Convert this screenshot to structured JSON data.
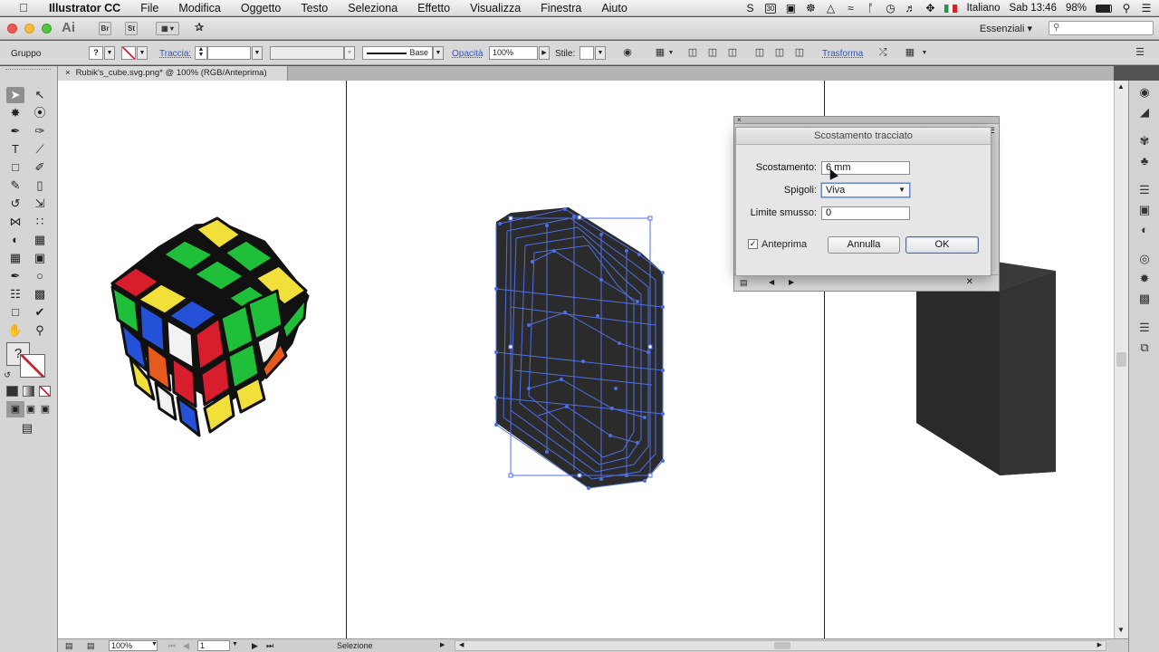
{
  "menubar": {
    "app_name": "Illustrator CC",
    "items": [
      "File",
      "Modifica",
      "Oggetto",
      "Testo",
      "Seleziona",
      "Effetto",
      "Visualizza",
      "Finestra",
      "Aiuto"
    ],
    "status": {
      "badge": "30",
      "language": "Italiano",
      "clock": "Sab 13:46",
      "battery": "98%"
    }
  },
  "appbar": {
    "logo": "Ai",
    "bridge": "Br",
    "stock": "St",
    "workspace": "Essenziali",
    "workspace_chevron": "▾"
  },
  "controlbar": {
    "selection_type": "Gruppo",
    "fill_label": "?",
    "stroke_label": "Traccia:",
    "stroke_profile": "Base",
    "opacity_label": "Opacità",
    "opacity_value": "100%",
    "style_label": "Stile:",
    "transform_label": "Trasforma"
  },
  "document": {
    "tab_title": "Rubik's_cube.svg.png* @ 100% (RGB/Anteprima)",
    "close_glyph": "×"
  },
  "tools": {
    "unknown_fill": "?"
  },
  "dialog": {
    "title": "Scostamento tracciato",
    "offset_label": "Scostamento:",
    "offset_value": "6 mm",
    "joins_label": "Spigoli:",
    "joins_value": "Viva",
    "miter_label": "Limite smusso:",
    "miter_value": "0",
    "preview_label": "Anteprima",
    "preview_checked": true,
    "cancel_label": "Annulla",
    "ok_label": "OK"
  },
  "statusbar": {
    "zoom": "100%",
    "artboard": "1",
    "tool": "Selezione"
  },
  "colors": {
    "selection_blue": "#4f6fe6",
    "cube_yellow": "#f2e03a",
    "cube_green": "#1fbf3a",
    "cube_red": "#d81e2c",
    "cube_blue": "#2550d8",
    "cube_orange": "#e65a1e",
    "object_dark": "#2b2b2b"
  }
}
